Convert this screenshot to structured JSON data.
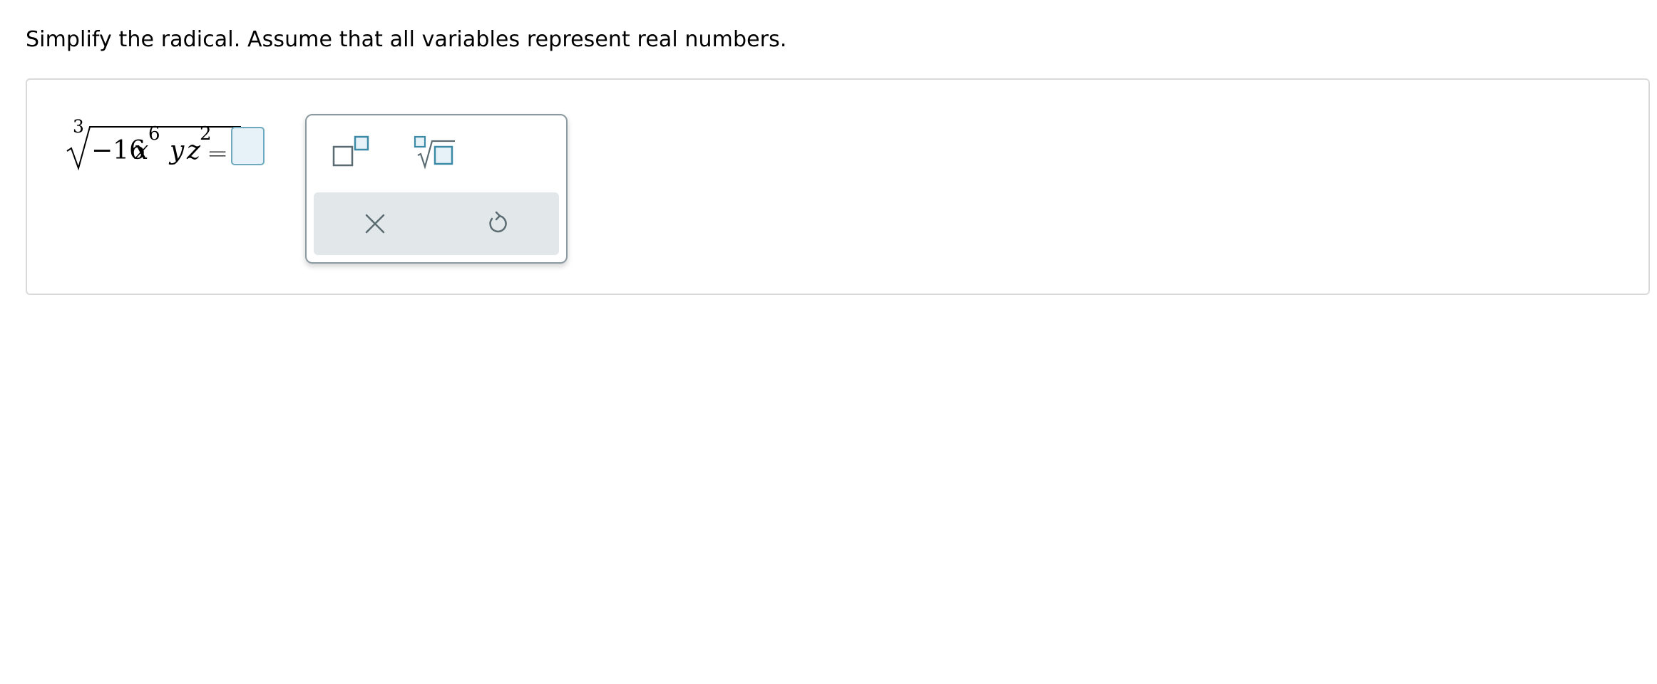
{
  "question": {
    "prompt": "Simplify the radical. Assume that all variables represent real numbers."
  },
  "expression": {
    "root_index": "3",
    "coefficient": "−16",
    "var1": "x",
    "var1_exponent": "6",
    "var2": "y",
    "var3": "z",
    "var3_exponent": "2",
    "equals": "="
  },
  "answer": {
    "value": ""
  },
  "palette": {
    "tools": [
      "exponent-template",
      "nth-root-template"
    ],
    "actions": [
      "clear",
      "undo"
    ]
  },
  "colors": {
    "accent": "#3d8aa6",
    "answer_box_fill": "#e6f2f8",
    "panel_border": "#d8dadb",
    "action_bar": "#e2e7e9",
    "icon_gray": "#5b6b72"
  }
}
